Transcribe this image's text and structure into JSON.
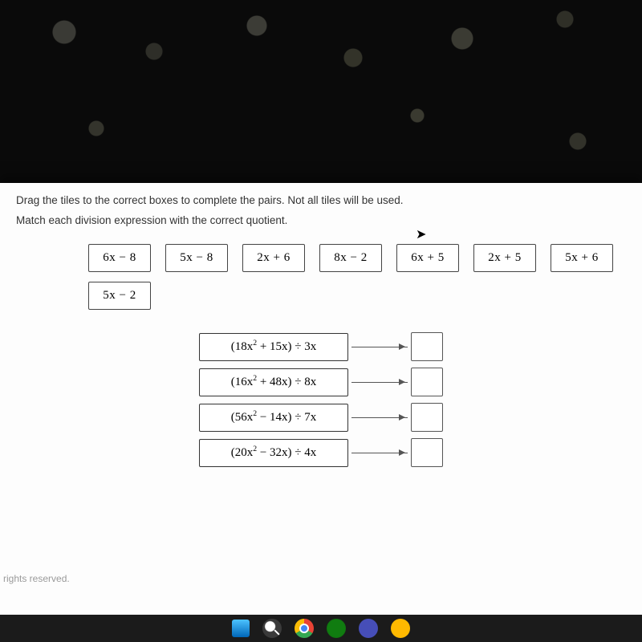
{
  "instructions": {
    "line1": "Drag the tiles to the correct boxes to complete the pairs. Not all tiles will be used.",
    "line2": "Match each division expression with the correct quotient."
  },
  "tiles": {
    "row1": [
      "6x − 8",
      "5x − 8",
      "2x + 6",
      "8x − 2",
      "6x + 5",
      "2x + 5",
      "5x + 6"
    ],
    "row2": [
      "5x − 2"
    ]
  },
  "pairs": [
    {
      "a": "18",
      "b": "15",
      "op": "+",
      "d": "3"
    },
    {
      "a": "16",
      "b": "48",
      "op": "+",
      "d": "8"
    },
    {
      "a": "56",
      "b": "14",
      "op": "−",
      "d": "7"
    },
    {
      "a": "20",
      "b": "32",
      "op": "−",
      "d": "4"
    }
  ],
  "footer": "rights reserved."
}
